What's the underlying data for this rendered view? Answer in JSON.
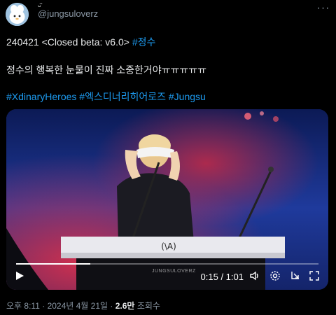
{
  "header": {
    "username": "@jungsuloverz",
    "name_mark": "ᵕ̈"
  },
  "tweet": {
    "line1_text": "240421 <Closed beta: v6.0> ",
    "line1_hashtag": "#정수",
    "line2": "정수의 행복한 눈물이 진짜 소중한거야ㅠㅠㅠㅠㅠ",
    "hashtags": [
      "#XdinaryHeroes",
      "#엑스디너리히어로즈",
      "#Jungsu"
    ]
  },
  "video": {
    "time": "0:15 / 1:01",
    "progress": 0.246,
    "watermark": "JUNGSULOVERZ",
    "keyboard_logo": "(\\A)"
  },
  "footer": {
    "time": "오후 8:11",
    "sep1": " · ",
    "date": "2024년 4월 21일",
    "sep2": " · ",
    "views": "2.6만",
    "views_label": " 조회수"
  },
  "colors": {
    "link": "#1d9bf0",
    "text": "#e7e9ea",
    "muted": "#8b98a5",
    "background": "#000000"
  }
}
